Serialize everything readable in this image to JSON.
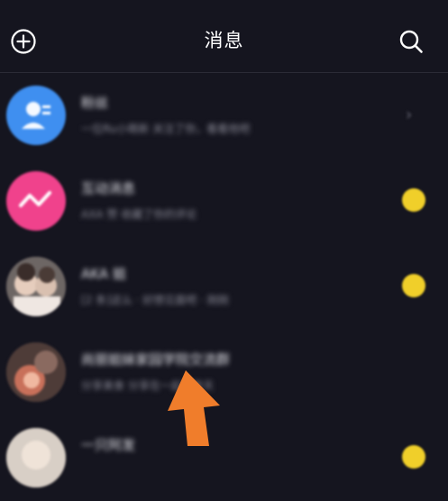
{
  "header": {
    "title": "消息",
    "left_icon": "add-circle-icon",
    "right_icon": "search-icon"
  },
  "messages": [
    {
      "name": "粉丝",
      "preview": "一位Ru小萌新 关注了你，看看他吧",
      "avatar_color": "#3f8ff0",
      "avatar_icon": "person-icon",
      "trailing": "chevron-right-icon"
    },
    {
      "name": "互动消息",
      "preview": "AXA 赞 收藏了你的评论",
      "avatar_color": "#f0428c",
      "avatar_icon": "wave-icon",
      "trailing": "unread-dot"
    },
    {
      "name": "AKA 姐",
      "preview": "[2 条]这么 · 好想见面吧 · 刚刚",
      "avatar_color": "#8a7a78",
      "avatar_icon": "photo-avatar",
      "trailing": "unread-dot"
    },
    {
      "name": "尚丽姐妹家园学院交流群",
      "preview": "分享美食 分享在一起 · 昨天",
      "avatar_color": "#6a4e48",
      "avatar_icon": "group-avatar",
      "trailing": "none"
    },
    {
      "name": "一只阿发",
      "preview": "",
      "avatar_color": "#c9b8a8",
      "avatar_icon": "photo-avatar",
      "trailing": "unread-dot"
    }
  ],
  "colors": {
    "background": "#15151f",
    "unread_dot": "#f0cf2a",
    "arrow": "#f07d2b"
  }
}
